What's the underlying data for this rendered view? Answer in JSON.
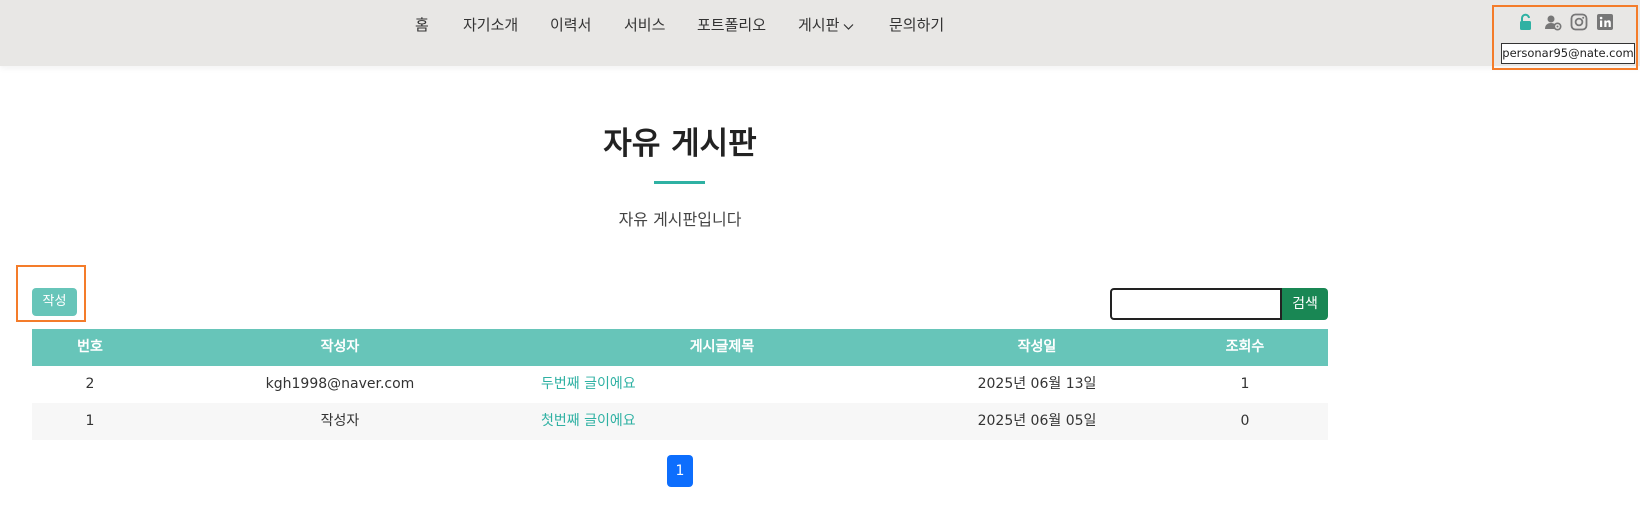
{
  "nav": {
    "items": [
      {
        "label": "홈"
      },
      {
        "label": "자기소개"
      },
      {
        "label": "이력서"
      },
      {
        "label": "서비스"
      },
      {
        "label": "포트폴리오"
      },
      {
        "label": "게시판"
      },
      {
        "label": "문의하기"
      }
    ]
  },
  "utility": {
    "icons": [
      "lock-open-icon",
      "user-gear-icon",
      "instagram-icon",
      "linkedin-icon"
    ],
    "email": "personar95@nate.com"
  },
  "page": {
    "title": "자유 게시판",
    "subtitle": "자유 게시판입니다"
  },
  "toolbar": {
    "write_label": "작성",
    "search_value": "",
    "search_label": "검색"
  },
  "table": {
    "headers": [
      "번호",
      "작성자",
      "게시글제목",
      "작성일",
      "조회수"
    ],
    "rows": [
      {
        "no": "2",
        "author": "kgh1998@naver.com",
        "title": "두번째 글이에요",
        "date": "2025년 06월 13일",
        "views": "1"
      },
      {
        "no": "1",
        "author": "작성자",
        "title": "첫번째 글이에요",
        "date": "2025년 06월 05일",
        "views": "0"
      }
    ]
  },
  "pagination": {
    "current": "1"
  },
  "colors": {
    "accent": "#67c5b9",
    "link": "#2fb1a3",
    "search_button": "#198754",
    "pager": "#0d6efd",
    "highlight_border": "#f47c2a"
  }
}
